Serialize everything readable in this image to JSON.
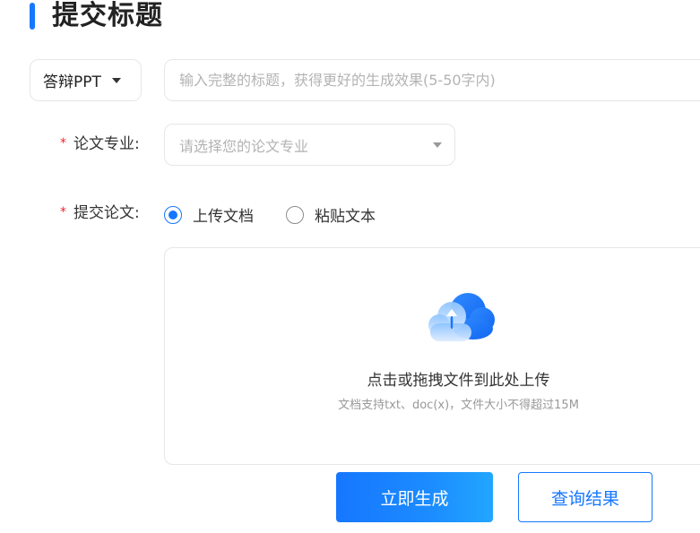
{
  "section": {
    "title": "提交标题"
  },
  "type_select": {
    "value": "答辩PPT"
  },
  "title_input": {
    "placeholder": "输入完整的标题，获得更好的生成效果(5-50字内)",
    "value": ""
  },
  "major": {
    "required_mark": "*",
    "label": "论文专业:",
    "placeholder": "请选择您的论文专业"
  },
  "submit_paper": {
    "required_mark": "*",
    "label": "提交论文:",
    "options": [
      {
        "label": "上传文档",
        "checked": true
      },
      {
        "label": "粘贴文本",
        "checked": false
      }
    ]
  },
  "upload": {
    "icon": "cloud-upload-icon",
    "main_text": "点击或拖拽文件到此处上传",
    "sub_text": "文档支持txt、doc(x)，文件大小不得超过15M"
  },
  "actions": {
    "generate_label": "立即生成",
    "query_label": "查询结果"
  },
  "colors": {
    "accent": "#1677ff",
    "required": "#f5222d",
    "border": "#e6e6e6",
    "placeholder": "#b3b3b3"
  }
}
